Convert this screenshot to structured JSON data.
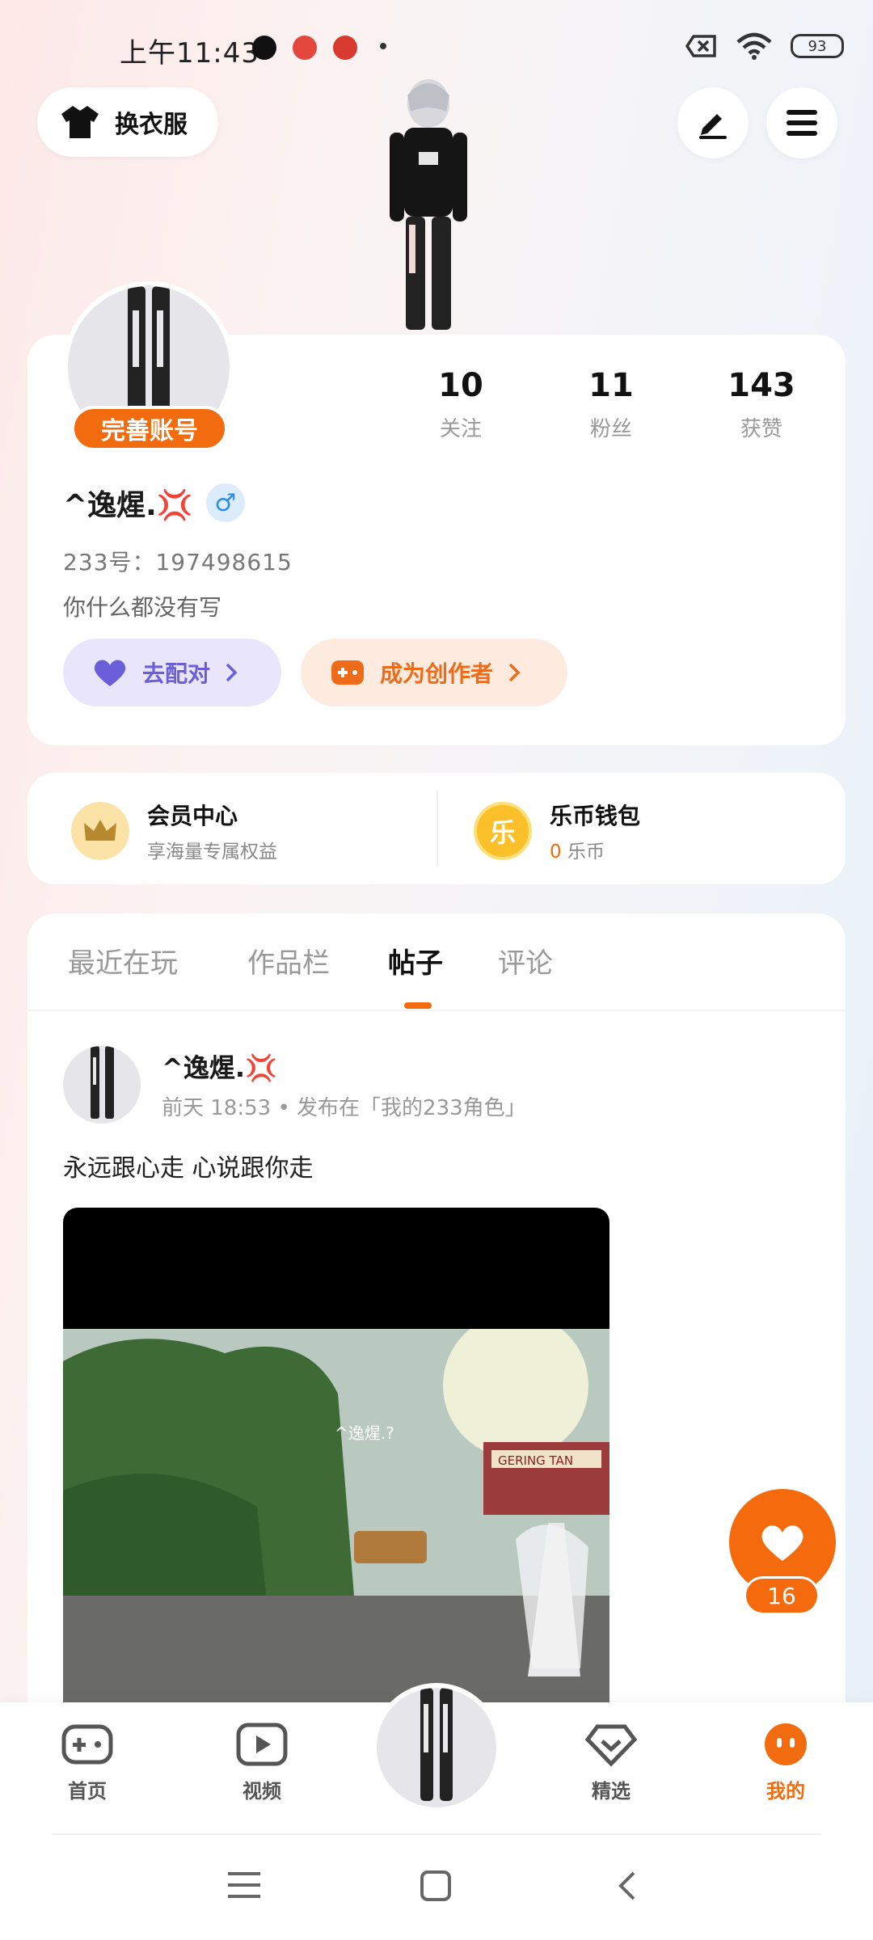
{
  "status_bar": {
    "time": "上午11:43",
    "battery": "93"
  },
  "header": {
    "outfit_label": "换衣服"
  },
  "profile": {
    "complete_label": "完善账号",
    "stats": [
      {
        "value": "10",
        "label": "关注"
      },
      {
        "value": "11",
        "label": "粉丝"
      },
      {
        "value": "143",
        "label": "获赞"
      }
    ],
    "username": "^逸煋.💢",
    "gender": "♂",
    "uid": "233号：197498615",
    "bio": "你什么都没有写",
    "pair_label": "去配对",
    "creator_label": "成为创作者"
  },
  "vip": {
    "member_title": "会员中心",
    "member_sub": "享海量专属权益",
    "wallet_title": "乐币钱包",
    "wallet_amount": "0",
    "wallet_unit": "乐币",
    "wallet_icon_char": "乐"
  },
  "tabs": [
    {
      "label": "最近在玩"
    },
    {
      "label": "作品栏"
    },
    {
      "label": "帖子"
    },
    {
      "label": "评论"
    }
  ],
  "post": {
    "author": "^逸煋.💢",
    "meta": "前天 18:53 • 发布在「我的233角色」",
    "text": "永远跟心走 心说跟你走",
    "media_caption": "^逸煋.?",
    "media_sign": "GERING TAN"
  },
  "like": {
    "count": "16"
  },
  "bottom_nav": [
    {
      "label": "首页"
    },
    {
      "label": "视频"
    },
    {
      "label": "精选"
    },
    {
      "label": "我的"
    }
  ],
  "colors": {
    "accent": "#f26b0f",
    "pair": "#6a5fd8",
    "gender": "#2e8de6"
  }
}
